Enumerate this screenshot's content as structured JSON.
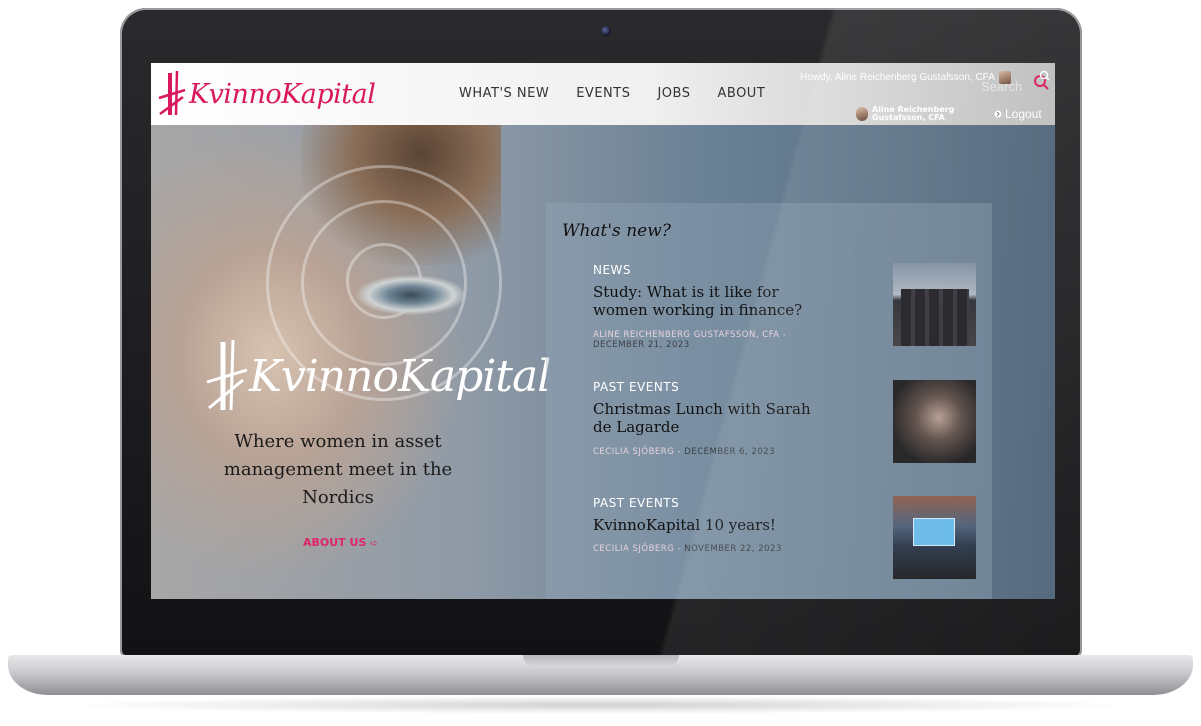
{
  "site": {
    "logo_text": "KvinnoKapital",
    "nav": [
      "WHAT'S NEW",
      "EVENTS",
      "JOBS",
      "ABOUT"
    ],
    "user_bar": {
      "howdy": "Howdy, Aline Reichenberg Gustafsson, CFA",
      "search_label": "Search",
      "user_name": "Aline Reichenberg Gustafsson, CFA",
      "logout": "Logout"
    }
  },
  "hero": {
    "logo_text": "KvinnoKapital",
    "tagline": "Where women in asset management meet in the Nordics",
    "about_link": "ABOUT US"
  },
  "news": {
    "title": "What's new?",
    "items": [
      {
        "category": "NEWS",
        "headline": "Study: What is it like for women working in finance?",
        "author": "ALINE REICHENBERG GUSTAFSSON, CFA",
        "separator": "-",
        "date": "DECEMBER 21, 2023"
      },
      {
        "category": "PAST EVENTS",
        "headline": "Christmas Lunch with Sarah de Lagarde",
        "author": "CECILIA SJÖBERG",
        "separator": "-",
        "date": "DECEMBER 6, 2023"
      },
      {
        "category": "PAST EVENTS",
        "headline": "KvinnoKapital 10 years!",
        "author": "CECILIA SJÖBERG",
        "separator": "-",
        "date": "NOVEMBER 22, 2023"
      }
    ]
  },
  "colors": {
    "brand_pink": "#d9185d",
    "laptop_bezel": "#1a1a1c"
  },
  "icons": [
    "search-icon",
    "logout-icon",
    "accessibility-icon",
    "arrow-right-icon"
  ]
}
